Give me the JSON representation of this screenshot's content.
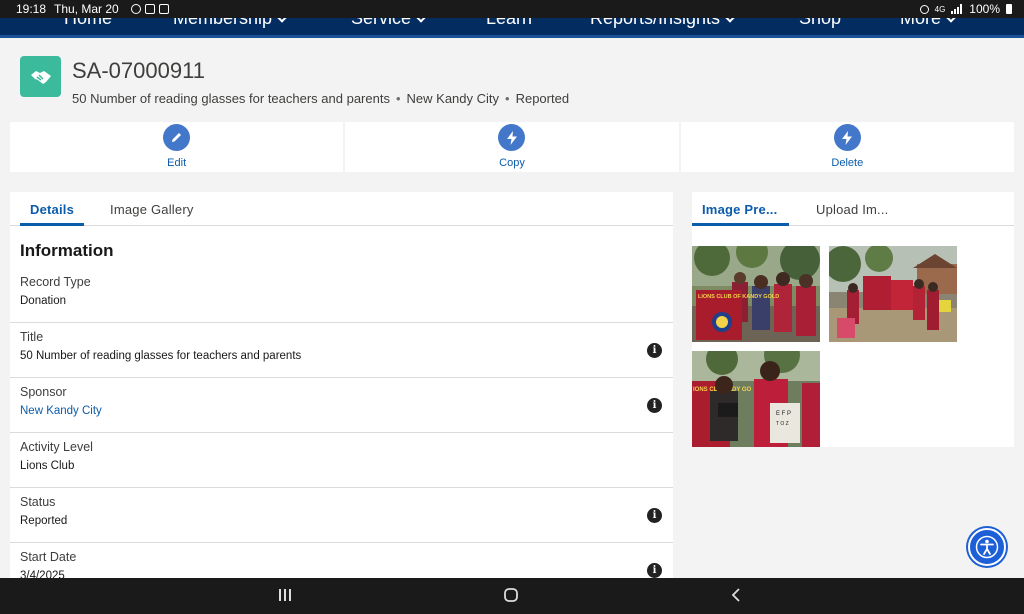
{
  "status_bar": {
    "time": "19:18",
    "date": "Thu, Mar 20",
    "signal": "4G",
    "battery": "100%"
  },
  "nav": {
    "items": [
      {
        "label": "Home",
        "has_menu": false
      },
      {
        "label": "Membership",
        "has_menu": true
      },
      {
        "label": "Service",
        "has_menu": true
      },
      {
        "label": "Learn",
        "has_menu": false
      },
      {
        "label": "Reports/Insights",
        "has_menu": true
      },
      {
        "label": "Shop",
        "has_menu": false
      },
      {
        "label": "More",
        "has_menu": true
      }
    ]
  },
  "record": {
    "icon": "handshake-icon",
    "id": "SA-07000911",
    "title": "50 Number of reading glasses for teachers and parents",
    "sponsor": "New Kandy City",
    "status": "Reported"
  },
  "actions": [
    {
      "label": "Edit",
      "icon": "edit-icon"
    },
    {
      "label": "Copy",
      "icon": "lightning-icon"
    },
    {
      "label": "Delete",
      "icon": "lightning-icon"
    }
  ],
  "left_tabs": [
    "Details",
    "Image Gallery"
  ],
  "information": {
    "heading": "Information",
    "fields": [
      {
        "label": "Record Type",
        "value": "Donation",
        "info": false,
        "link": false
      },
      {
        "label": "Title",
        "value": "50 Number of reading glasses for teachers and parents",
        "info": true,
        "link": false
      },
      {
        "label": "Sponsor",
        "value": "New Kandy City",
        "info": true,
        "link": true
      },
      {
        "label": "Activity Level",
        "value": "Lions Club",
        "info": false,
        "link": false
      },
      {
        "label": "Status",
        "value": "Reported",
        "info": true,
        "link": false
      },
      {
        "label": "Start Date",
        "value": "3/4/2025",
        "info": true,
        "link": false
      }
    ]
  },
  "right_tabs": [
    "Image Pre...",
    "Upload Im..."
  ],
  "photos": [
    {
      "banner_text": "LIONS CLUB OF KANDY GOLD"
    },
    {
      "banner_text": ""
    },
    {
      "banner_text": "IONS CLUB NDY GO"
    }
  ],
  "colors": {
    "nav_bg": "#032d60",
    "brand_blue": "#0b5cab",
    "record_icon": "#3bba9c",
    "action_circle": "#4277c9"
  }
}
